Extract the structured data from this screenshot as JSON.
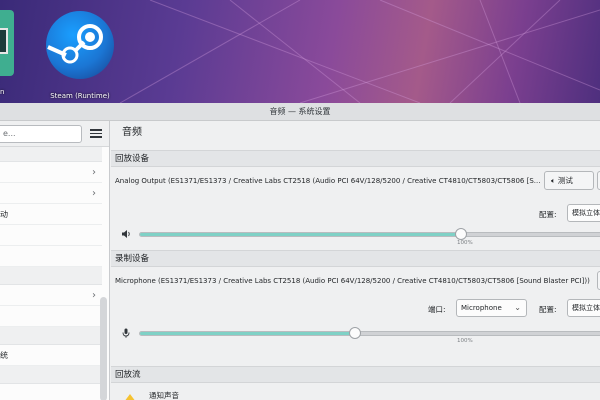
{
  "desktop": {
    "left_app_label": "n",
    "steam_label": "Steam (Runtime)"
  },
  "window": {
    "title": "音频 — 系统设置"
  },
  "sidebar": {
    "search_value": "e...",
    "items": [
      {
        "label": "",
        "has_chevron": true
      },
      {
        "label": "",
        "has_chevron": true
      },
      {
        "label": "动",
        "has_chevron": false
      },
      {
        "label": "",
        "has_chevron": false
      },
      {
        "label": "",
        "has_chevron": false
      },
      {
        "label": "",
        "has_chevron": true
      },
      {
        "label": "",
        "has_chevron": false
      },
      {
        "label": "统",
        "has_chevron": false
      }
    ]
  },
  "page": {
    "title": "音频"
  },
  "playback": {
    "section_label": "回放设备",
    "device_name": "Analog Output (ES1371/ES1373 / Creative Labs CT2518 (Audio PCI 64V/128/5200 / Creative CT4810/CT5803/CT5806 [S...",
    "test_label": "测试",
    "config_label": "配置:",
    "config_value": "模拟立体",
    "volume_percent": 100,
    "volume_text": "100%"
  },
  "recording": {
    "section_label": "录制设备",
    "device_name": "Microphone (ES1371/ES1373 / Creative Labs CT2518 (Audio PCI 64V/128/5200 / Creative CT4810/CT5803/CT5806 [Sound Blaster PCI]))",
    "port_label": "端口:",
    "port_value": "Microphone",
    "config_label": "配置:",
    "config_value": "模拟立体",
    "volume_percent": 100,
    "volume_text": "100%"
  },
  "streams": {
    "section_label": "回放流",
    "items": [
      {
        "name": "通知声音",
        "icon": "warning-icon"
      }
    ]
  },
  "colors": {
    "slider_fill": "#7fd1c6",
    "accent": "#3daee9"
  }
}
